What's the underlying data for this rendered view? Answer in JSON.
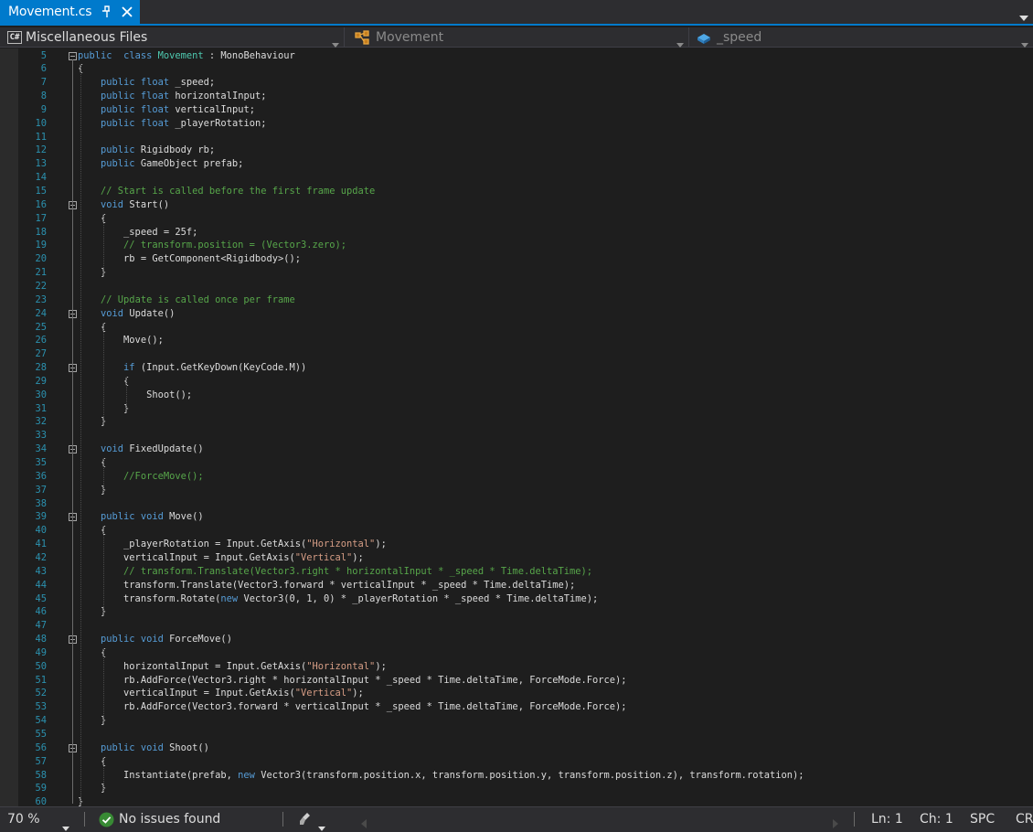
{
  "tab": {
    "title": "Movement.cs"
  },
  "navbar": {
    "project": "Miscellaneous Files",
    "type": "Movement",
    "member": "_speed"
  },
  "editor": {
    "lines": [
      {
        "n": "5",
        "tokens": [
          [
            "kw",
            "public"
          ],
          [
            "",
            "  "
          ],
          [
            "kw",
            "class"
          ],
          [
            "",
            " "
          ],
          [
            "ty",
            "Movement"
          ],
          [
            "",
            " : MonoBehaviour"
          ]
        ]
      },
      {
        "n": "6",
        "tokens": [
          [
            "",
            "{"
          ]
        ]
      },
      {
        "n": "7",
        "tokens": [
          [
            "",
            "    "
          ],
          [
            "kw",
            "public"
          ],
          [
            "",
            " "
          ],
          [
            "kw",
            "float"
          ],
          [
            "",
            " _speed;"
          ]
        ]
      },
      {
        "n": "8",
        "tokens": [
          [
            "",
            "    "
          ],
          [
            "kw",
            "public"
          ],
          [
            "",
            " "
          ],
          [
            "kw",
            "float"
          ],
          [
            "",
            " horizontalInput;"
          ]
        ]
      },
      {
        "n": "9",
        "tokens": [
          [
            "",
            "    "
          ],
          [
            "kw",
            "public"
          ],
          [
            "",
            " "
          ],
          [
            "kw",
            "float"
          ],
          [
            "",
            " verticalInput;"
          ]
        ]
      },
      {
        "n": "10",
        "tokens": [
          [
            "",
            "    "
          ],
          [
            "kw",
            "public"
          ],
          [
            "",
            " "
          ],
          [
            "kw",
            "float"
          ],
          [
            "",
            " _playerRotation;"
          ]
        ]
      },
      {
        "n": "11",
        "tokens": []
      },
      {
        "n": "12",
        "tokens": [
          [
            "",
            "    "
          ],
          [
            "kw",
            "public"
          ],
          [
            "",
            " Rigidbody rb;"
          ]
        ]
      },
      {
        "n": "13",
        "tokens": [
          [
            "",
            "    "
          ],
          [
            "kw",
            "public"
          ],
          [
            "",
            " GameObject prefab;"
          ]
        ]
      },
      {
        "n": "14",
        "tokens": []
      },
      {
        "n": "15",
        "tokens": [
          [
            "",
            "    "
          ],
          [
            "cm",
            "// Start is called before the first frame update"
          ]
        ]
      },
      {
        "n": "16",
        "tokens": [
          [
            "",
            "    "
          ],
          [
            "kw",
            "void"
          ],
          [
            "",
            " Start()"
          ]
        ]
      },
      {
        "n": "17",
        "tokens": [
          [
            "",
            "    {"
          ]
        ]
      },
      {
        "n": "18",
        "tokens": [
          [
            "",
            "        _speed = 25f;"
          ]
        ]
      },
      {
        "n": "19",
        "tokens": [
          [
            "",
            "        "
          ],
          [
            "cm",
            "// transform.position = (Vector3.zero);"
          ]
        ]
      },
      {
        "n": "20",
        "tokens": [
          [
            "",
            "        rb = GetComponent<Rigidbody>();"
          ]
        ]
      },
      {
        "n": "21",
        "tokens": [
          [
            "",
            "    }"
          ]
        ]
      },
      {
        "n": "22",
        "tokens": []
      },
      {
        "n": "23",
        "tokens": [
          [
            "",
            "    "
          ],
          [
            "cm",
            "// Update is called once per frame"
          ]
        ]
      },
      {
        "n": "24",
        "tokens": [
          [
            "",
            "    "
          ],
          [
            "kw",
            "void"
          ],
          [
            "",
            " Update()"
          ]
        ]
      },
      {
        "n": "25",
        "tokens": [
          [
            "",
            "    {"
          ]
        ]
      },
      {
        "n": "26",
        "tokens": [
          [
            "",
            "        Move();"
          ]
        ]
      },
      {
        "n": "27",
        "tokens": []
      },
      {
        "n": "28",
        "tokens": [
          [
            "",
            "        "
          ],
          [
            "kw",
            "if"
          ],
          [
            "",
            " (Input.GetKeyDown(KeyCode.M))"
          ]
        ]
      },
      {
        "n": "29",
        "tokens": [
          [
            "",
            "        {"
          ]
        ]
      },
      {
        "n": "30",
        "tokens": [
          [
            "",
            "            Shoot();"
          ]
        ]
      },
      {
        "n": "31",
        "tokens": [
          [
            "",
            "        }"
          ]
        ]
      },
      {
        "n": "32",
        "tokens": [
          [
            "",
            "    }"
          ]
        ]
      },
      {
        "n": "33",
        "tokens": []
      },
      {
        "n": "34",
        "tokens": [
          [
            "",
            "    "
          ],
          [
            "kw",
            "void"
          ],
          [
            "",
            " FixedUpdate()"
          ]
        ]
      },
      {
        "n": "35",
        "tokens": [
          [
            "",
            "    {"
          ]
        ]
      },
      {
        "n": "36",
        "tokens": [
          [
            "",
            "        "
          ],
          [
            "cm",
            "//ForceMove();"
          ]
        ]
      },
      {
        "n": "37",
        "tokens": [
          [
            "",
            "    }"
          ]
        ]
      },
      {
        "n": "38",
        "tokens": []
      },
      {
        "n": "39",
        "tokens": [
          [
            "",
            "    "
          ],
          [
            "kw",
            "public"
          ],
          [
            "",
            " "
          ],
          [
            "kw",
            "void"
          ],
          [
            "",
            " Move()"
          ]
        ]
      },
      {
        "n": "40",
        "tokens": [
          [
            "",
            "    {"
          ]
        ]
      },
      {
        "n": "41",
        "tokens": [
          [
            "",
            "        _playerRotation = Input.GetAxis("
          ],
          [
            "st",
            "\"Horizontal\""
          ],
          [
            "",
            ");"
          ]
        ]
      },
      {
        "n": "42",
        "tokens": [
          [
            "",
            "        verticalInput = Input.GetAxis("
          ],
          [
            "st",
            "\"Vertical\""
          ],
          [
            "",
            ");"
          ]
        ]
      },
      {
        "n": "43",
        "tokens": [
          [
            "",
            "        "
          ],
          [
            "cm",
            "// transform.Translate(Vector3.right * horizontalInput * _speed * Time.deltaTime);"
          ]
        ]
      },
      {
        "n": "44",
        "tokens": [
          [
            "",
            "        transform.Translate(Vector3.forward * verticalInput * _speed * Time.deltaTime);"
          ]
        ]
      },
      {
        "n": "45",
        "tokens": [
          [
            "",
            "        transform.Rotate("
          ],
          [
            "kw",
            "new"
          ],
          [
            "",
            " Vector3(0, 1, 0) * _playerRotation * _speed * Time.deltaTime);"
          ]
        ]
      },
      {
        "n": "46",
        "tokens": [
          [
            "",
            "    }"
          ]
        ]
      },
      {
        "n": "47",
        "tokens": []
      },
      {
        "n": "48",
        "tokens": [
          [
            "",
            "    "
          ],
          [
            "kw",
            "public"
          ],
          [
            "",
            " "
          ],
          [
            "kw",
            "void"
          ],
          [
            "",
            " ForceMove()"
          ]
        ]
      },
      {
        "n": "49",
        "tokens": [
          [
            "",
            "    {"
          ]
        ]
      },
      {
        "n": "50",
        "tokens": [
          [
            "",
            "        horizontalInput = Input.GetAxis("
          ],
          [
            "st",
            "\"Horizontal\""
          ],
          [
            "",
            ");"
          ]
        ]
      },
      {
        "n": "51",
        "tokens": [
          [
            "",
            "        rb.AddForce(Vector3.right * horizontalInput * _speed * Time.deltaTime, ForceMode.Force);"
          ]
        ]
      },
      {
        "n": "52",
        "tokens": [
          [
            "",
            "        verticalInput = Input.GetAxis("
          ],
          [
            "st",
            "\"Vertical\""
          ],
          [
            "",
            ");"
          ]
        ]
      },
      {
        "n": "53",
        "tokens": [
          [
            "",
            "        rb.AddForce(Vector3.forward * verticalInput * _speed * Time.deltaTime, ForceMode.Force);"
          ]
        ]
      },
      {
        "n": "54",
        "tokens": [
          [
            "",
            "    }"
          ]
        ]
      },
      {
        "n": "55",
        "tokens": []
      },
      {
        "n": "56",
        "tokens": [
          [
            "",
            "    "
          ],
          [
            "kw",
            "public"
          ],
          [
            "",
            " "
          ],
          [
            "kw",
            "void"
          ],
          [
            "",
            " Shoot()"
          ]
        ]
      },
      {
        "n": "57",
        "tokens": [
          [
            "",
            "    {"
          ]
        ]
      },
      {
        "n": "58",
        "tokens": [
          [
            "",
            "        Instantiate(prefab, "
          ],
          [
            "kw",
            "new"
          ],
          [
            "",
            " Vector3(transform.position.x, transform.position.y, transform.position.z), transform.rotation);"
          ]
        ]
      },
      {
        "n": "59",
        "tokens": [
          [
            "",
            "    }"
          ]
        ]
      },
      {
        "n": "60",
        "tokens": [
          [
            "",
            "}"
          ]
        ]
      }
    ]
  },
  "statusbar": {
    "zoom": "70 %",
    "issues": "No issues found",
    "line": "Ln: 1",
    "col": "Ch: 1",
    "whitespace": "SPC",
    "line_ending": "CRLF"
  },
  "colors": {
    "accent": "#007acc",
    "keyword": "#569cd6",
    "type": "#4ec9b0",
    "comment": "#57a64a",
    "string": "#d69d85",
    "line_number": "#2b91af",
    "ok": "#388a34"
  }
}
